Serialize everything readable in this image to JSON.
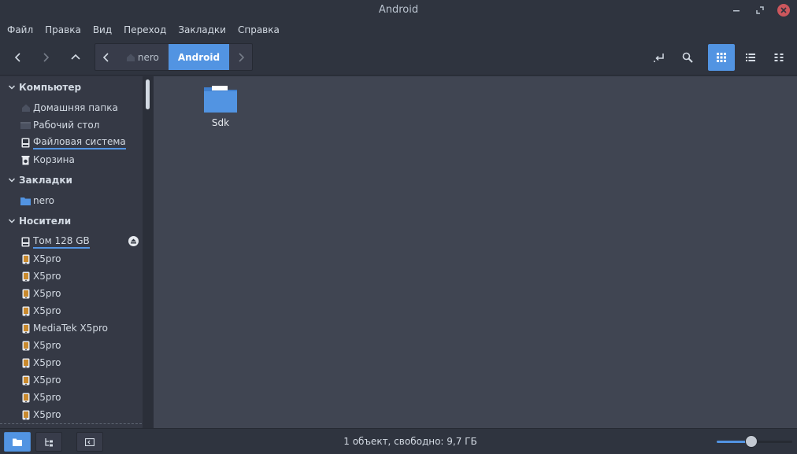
{
  "window": {
    "title": "Android"
  },
  "menu": [
    "Файл",
    "Правка",
    "Вид",
    "Переход",
    "Закладки",
    "Справка"
  ],
  "path": {
    "home": "nero",
    "current": "Android"
  },
  "sidebar": {
    "sections": [
      {
        "title": "Компьютер",
        "items": [
          {
            "label": "Домашняя папка",
            "icon": "home-icon"
          },
          {
            "label": "Рабочий стол",
            "icon": "desktop-icon"
          },
          {
            "label": "Файловая система",
            "icon": "drive-icon"
          },
          {
            "label": "Корзина",
            "icon": "trash-icon"
          }
        ]
      },
      {
        "title": "Закладки",
        "items": [
          {
            "label": "nero",
            "icon": "folder-icon"
          }
        ]
      },
      {
        "title": "Носители",
        "items": [
          {
            "label": "Том 128 GB",
            "icon": "drive-icon"
          },
          {
            "label": "X5pro",
            "icon": "phone-icon"
          },
          {
            "label": "X5pro",
            "icon": "phone-icon"
          },
          {
            "label": "X5pro",
            "icon": "phone-icon"
          },
          {
            "label": "X5pro",
            "icon": "phone-icon"
          },
          {
            "label": "MediaTek X5pro",
            "icon": "phone-icon"
          },
          {
            "label": "X5pro",
            "icon": "phone-icon"
          },
          {
            "label": "X5pro",
            "icon": "phone-icon"
          },
          {
            "label": "X5pro",
            "icon": "phone-icon"
          },
          {
            "label": "X5pro",
            "icon": "phone-icon"
          },
          {
            "label": "X5pro",
            "icon": "phone-icon"
          }
        ]
      }
    ]
  },
  "content": {
    "items": [
      {
        "name": "Sdk",
        "type": "folder"
      }
    ]
  },
  "status": {
    "text": "1 объект, свободно: 9,7 ГБ",
    "zoom_level": 0.45
  },
  "colors": {
    "accent": "#5294e2",
    "background": "#2f343f",
    "view": "#404552",
    "sidebar": "#353945",
    "close": "#cc575d"
  }
}
